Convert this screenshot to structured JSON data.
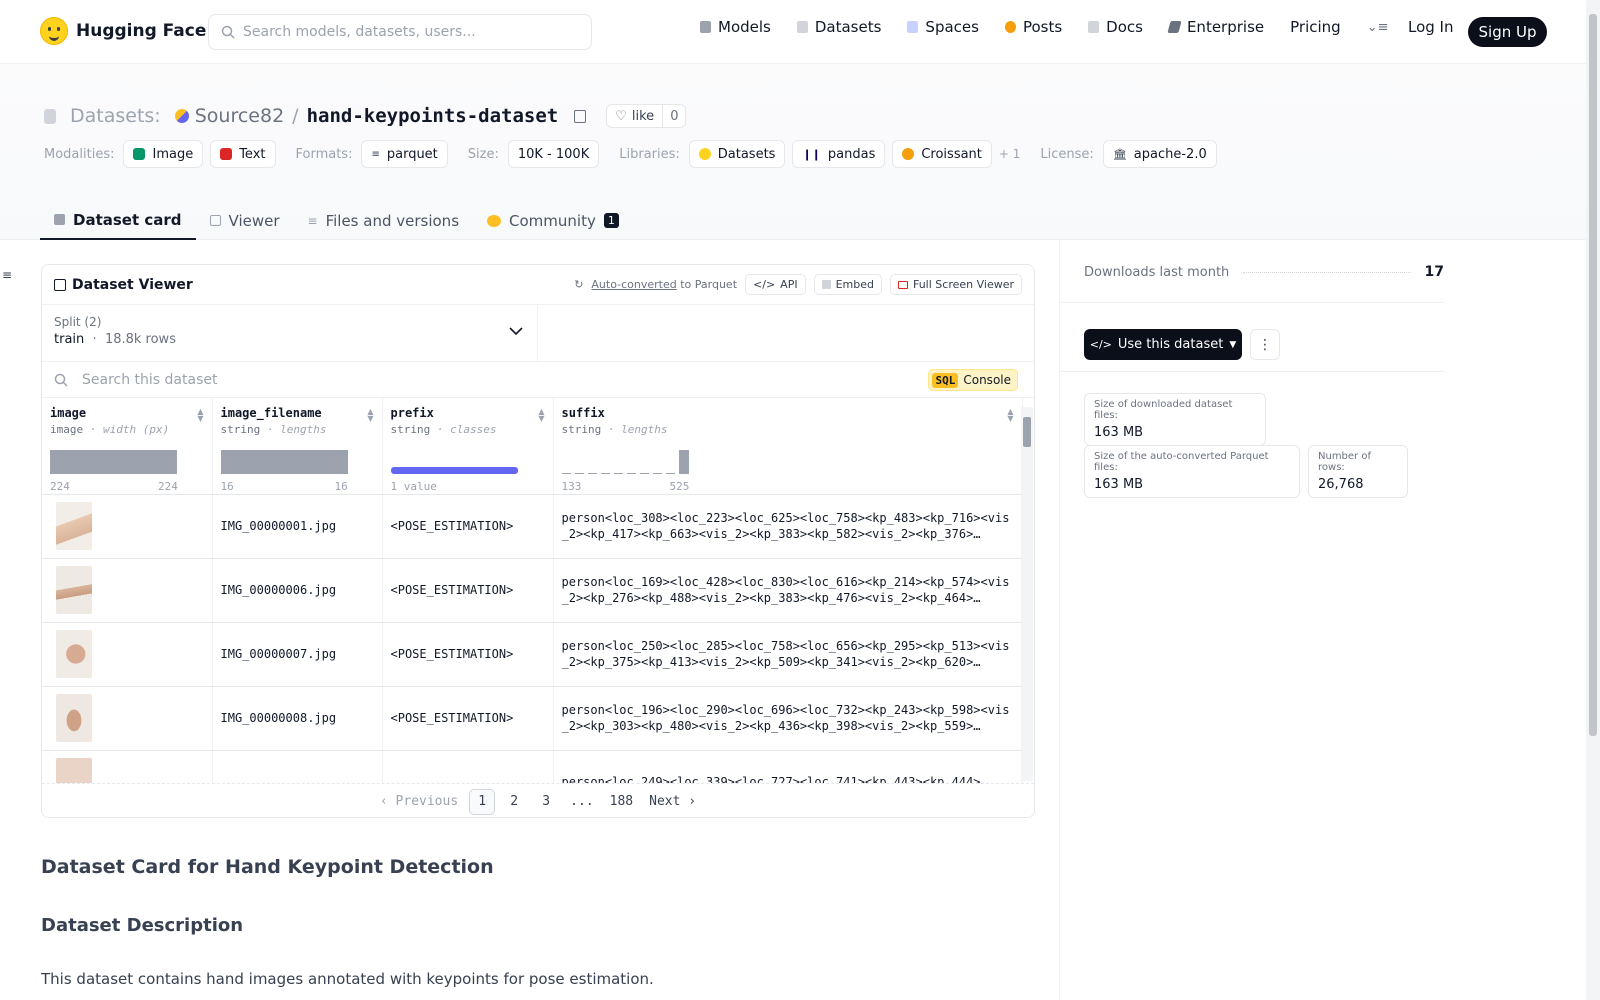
{
  "nav": {
    "brand": "Hugging Face",
    "search_placeholder": "Search models, datasets, users...",
    "links": [
      {
        "label": "Models",
        "icon": "models-icon",
        "color": "#9ca3af"
      },
      {
        "label": "Datasets",
        "icon": "datasets-icon",
        "color": "#d1d5db"
      },
      {
        "label": "Spaces",
        "icon": "spaces-icon",
        "color": "#a5b4fc"
      },
      {
        "label": "Posts",
        "icon": "posts-icon",
        "color": "#f59e0b"
      },
      {
        "label": "Docs",
        "icon": "docs-icon",
        "color": "#d1d5db"
      },
      {
        "label": "Enterprise",
        "icon": "enterprise-icon",
        "color": "#6b7280"
      },
      {
        "label": "Pricing",
        "icon": "",
        "color": ""
      }
    ],
    "login": "Log In",
    "signup": "Sign Up"
  },
  "header": {
    "section": "Datasets:",
    "owner": "Source82",
    "repo": "hand-keypoints-dataset",
    "like_label": "like",
    "like_count": "0",
    "modalities_label": "Modalities:",
    "modalities": [
      "Image",
      "Text"
    ],
    "formats_label": "Formats:",
    "formats": [
      "parquet"
    ],
    "size_label": "Size:",
    "size": "10K - 100K",
    "libraries_label": "Libraries:",
    "libraries": [
      "Datasets",
      "pandas",
      "Croissant"
    ],
    "libraries_more": "+ 1",
    "license_label": "License:",
    "license": "apache-2.0"
  },
  "tabs": [
    {
      "label": "Dataset card",
      "active": true
    },
    {
      "label": "Viewer",
      "active": false
    },
    {
      "label": "Files and versions",
      "active": false
    },
    {
      "label": "Community",
      "active": false,
      "badge": "1"
    }
  ],
  "viewer": {
    "title": "Dataset Viewer",
    "auto_converted": "Auto-converted",
    "to_parquet": "to Parquet",
    "api": "API",
    "embed": "Embed",
    "full_screen": "Full Screen Viewer",
    "split_label": "Split (2)",
    "split_name": "train",
    "split_rows": "18.8k rows",
    "search_placeholder": "Search this dataset",
    "sql": "SQL",
    "console": "Console",
    "columns": [
      {
        "name": "image",
        "type": "image",
        "stat": "width (px)",
        "min": "224",
        "max": "224"
      },
      {
        "name": "image_filename",
        "type": "string",
        "stat": "lengths",
        "min": "16",
        "max": "16"
      },
      {
        "name": "prefix",
        "type": "string",
        "stat": "classes",
        "min": "1 value",
        "max": ""
      },
      {
        "name": "suffix",
        "type": "string",
        "stat": "lengths",
        "min": "133",
        "max": "525"
      }
    ],
    "rows": [
      {
        "filename": "IMG_00000001.jpg",
        "prefix": "<POSE_ESTIMATION>",
        "suffix": "person<loc_308><loc_223><loc_625><loc_758><kp_483><kp_716><vis_2><kp_417><kp_663><vis_2><kp_383><kp_582><vis_2><kp_376>…",
        "thumb": "#e8c9b0"
      },
      {
        "filename": "IMG_00000006.jpg",
        "prefix": "<POSE_ESTIMATION>",
        "suffix": "person<loc_169><loc_428><loc_830><loc_616><kp_214><kp_574><vis_2><kp_276><kp_488><vis_2><kp_383><kp_476><vis_2><kp_464>…",
        "thumb": "#d9b49a"
      },
      {
        "filename": "IMG_00000007.jpg",
        "prefix": "<POSE_ESTIMATION>",
        "suffix": "person<loc_250><loc_285><loc_758><loc_656><kp_295><kp_513><vis_2><kp_375><kp_413><vis_2><kp_509><kp_341><vis_2><kp_620>…",
        "thumb": "#dcb9a3"
      },
      {
        "filename": "IMG_00000008.jpg",
        "prefix": "<POSE_ESTIMATION>",
        "suffix": "person<loc_196><loc_290><loc_696><loc_732><kp_243><kp_598><vis_2><kp_303><kp_480><vis_2><kp_436><kp_398><vis_2><kp_559>…",
        "thumb": "#d4ad94"
      },
      {
        "filename": "",
        "prefix": "",
        "suffix": "person<loc_249><loc_339><loc_727><loc_741><kp_443><kp_444>",
        "thumb": "#e6c4b3"
      }
    ],
    "pager": {
      "prev": "Previous",
      "pages": [
        "1",
        "2",
        "3",
        "...",
        "188"
      ],
      "next": "Next"
    }
  },
  "card": {
    "h1": "Dataset Card for Hand Keypoint Detection",
    "h2": "Dataset Description",
    "p": "This dataset contains hand images annotated with keypoints for pose estimation."
  },
  "sidebar": {
    "downloads_label": "Downloads last month",
    "downloads": "17",
    "use_button": "Use this dataset",
    "stats": [
      {
        "label": "Size of downloaded dataset files:",
        "value": "163 MB"
      },
      {
        "label": "Size of the auto-converted Parquet files:",
        "value": "163 MB"
      },
      {
        "label": "Number of rows:",
        "value": "26,768"
      }
    ]
  },
  "colors": {
    "accent_dark": "#0b0f19",
    "brand_yellow": "#ffd21e",
    "histogram_gray": "#9ca3af",
    "class_bar": "#6366f1"
  }
}
